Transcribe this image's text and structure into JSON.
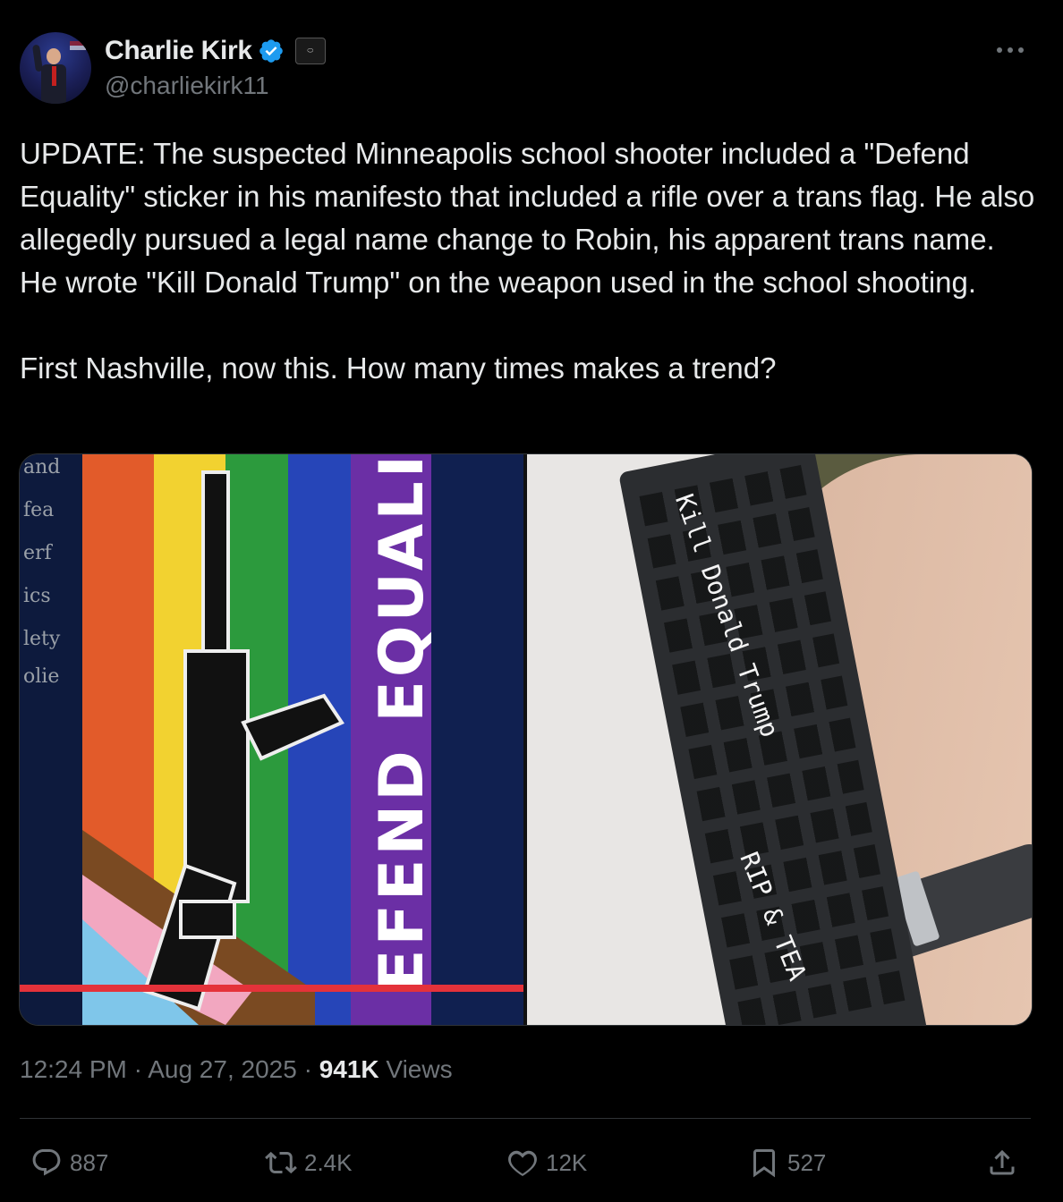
{
  "author": {
    "display_name": "Charlie Kirk",
    "handle": "@charliekirk11",
    "verified": true,
    "avatar_icon": "profile-photo"
  },
  "tweet": {
    "text": "UPDATE: The suspected Minneapolis school shooter included a \"Defend Equality\" sticker in his manifesto that included a rifle over a trans flag. He also allegedly pursued a legal name change to Robin, his apparent trans name. He wrote \"Kill Donald Trump\" on the weapon used in the school shooting.\n\nFirst Nashville, now this. How many times makes a trend?",
    "time": "12:24 PM",
    "date": "Aug 27, 2025",
    "separator": "·",
    "views_count": "941K",
    "views_label": "Views"
  },
  "media": {
    "left": {
      "sticker_text": "EFEND EQUALIT",
      "side_text": [
        "and",
        "fea",
        "erf",
        "ics",
        "lety",
        "olie"
      ]
    },
    "right": {
      "handguard_text_1": "Kill Donald Trump",
      "handguard_text_2": "RIP & TEA"
    }
  },
  "actions": {
    "replies": "887",
    "reposts": "2.4K",
    "likes": "12K",
    "bookmarks": "527"
  },
  "colors": {
    "background": "#000000",
    "text": "#e7e9ea",
    "muted": "#71767b",
    "verified": "#1d9bf0",
    "divider": "#2f3336"
  }
}
